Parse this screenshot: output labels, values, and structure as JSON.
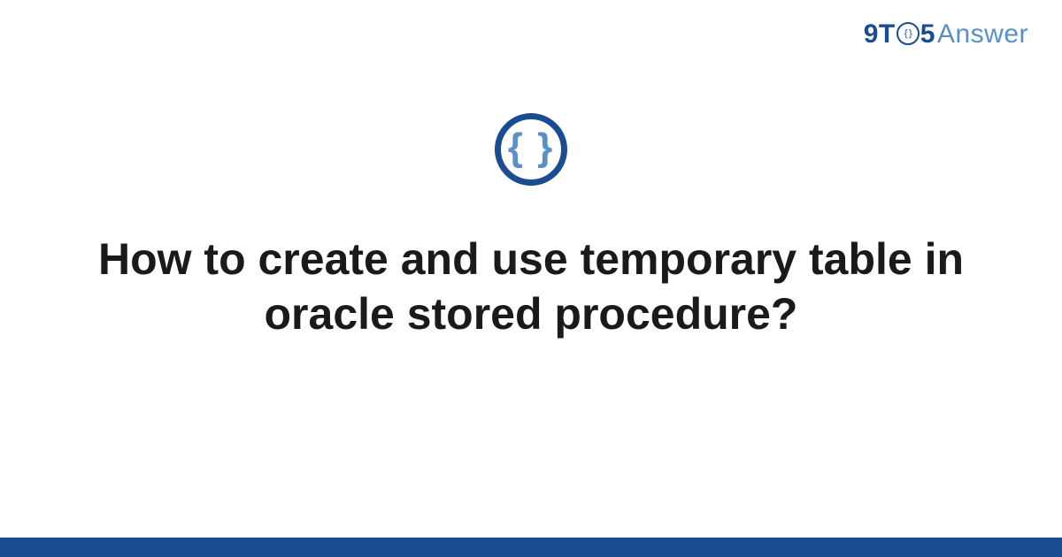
{
  "brand": {
    "prefix": "9T",
    "circle_inner": "{ }",
    "suffix": "5",
    "word": "Answer"
  },
  "center_icon": {
    "glyph": "{ }",
    "name": "code-braces-icon"
  },
  "title": "How to create and use temporary table in oracle stored procedure?",
  "colors": {
    "primary": "#1a4d8f",
    "accent": "#5a8fc7"
  }
}
